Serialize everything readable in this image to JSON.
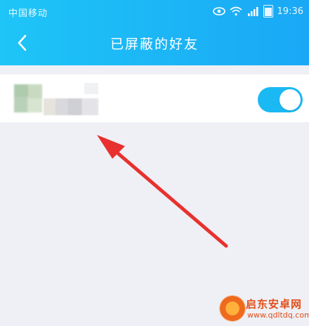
{
  "status_bar": {
    "carrier": "中国移动",
    "time": "19:36",
    "icons": [
      "eye-icon",
      "wifi-icon",
      "signal-icon",
      "battery-icon"
    ]
  },
  "nav": {
    "back_icon": "chevron-left-icon",
    "title": "已屏蔽的好友"
  },
  "blocked_friend": {
    "avatar": "blurred-avatar",
    "name": "",
    "toggle_on": true
  },
  "colors": {
    "header_start": "#1ec5f7",
    "header_end": "#1aa8f6",
    "toggle": "#1bb9f3",
    "annotation_arrow": "#e8312e",
    "background": "#eef0f5"
  },
  "watermark": {
    "brand": "启东安卓网",
    "url": "www.qdltdq.com"
  }
}
